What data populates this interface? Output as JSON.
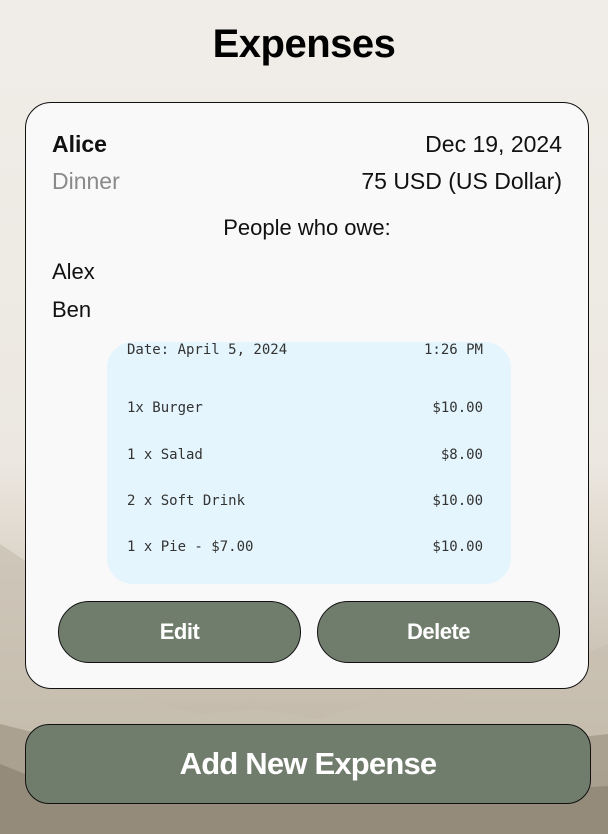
{
  "page": {
    "title": "Expenses"
  },
  "expense": {
    "payer": "Alice",
    "date": "Dec 19, 2024",
    "category": "Dinner",
    "amount": "75 USD (US Dollar)",
    "owe_title": "People who owe:",
    "owers": [
      "Alex",
      "Ben"
    ],
    "receipt": {
      "date": "Date: April 5, 2024",
      "time": "1:26 PM",
      "items": [
        {
          "name": "1x Burger",
          "price": "$10.00"
        },
        {
          "name": "1 x Salad",
          "price": "$8.00"
        },
        {
          "name": "2 x Soft Drink",
          "price": "$10.00"
        },
        {
          "name": "1 x Pie - $7.00",
          "price": "$10.00"
        }
      ]
    },
    "edit_label": "Edit",
    "delete_label": "Delete"
  },
  "actions": {
    "add_label": "Add New Expense"
  },
  "colors": {
    "button": "#717d6c",
    "receipt_bg": "#e4f5fd",
    "card_bg": "#f9f9f9"
  }
}
